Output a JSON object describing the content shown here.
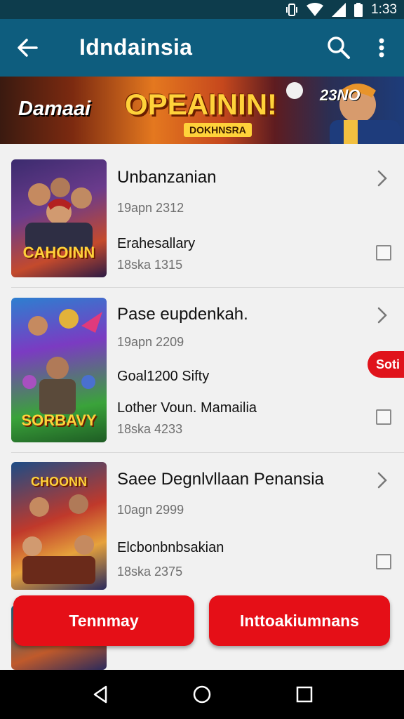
{
  "status_bar": {
    "time": "1:33",
    "icons": [
      "vibrate-icon",
      "wifi-icon",
      "signal-icon",
      "battery-icon"
    ]
  },
  "app_bar": {
    "title": "Idndainsia",
    "icons": [
      "back-arrow-icon",
      "search-icon",
      "more-vert-icon"
    ]
  },
  "banner": {
    "left_text": "Damaai",
    "logo_text": "OPEAININ!",
    "logo_sub": "DOKHNSRA",
    "right_text": "23NO"
  },
  "items": [
    {
      "title": "Unbanzanian",
      "date": "19apn 2312",
      "sub1": "Erahesallary",
      "sub2": "",
      "number": "18ska 1315",
      "thumb_text": "CAHOINN",
      "checked": false
    },
    {
      "title": "Pase eupdenkah.",
      "date": "19apn 2209",
      "sub1": "Goal1200 Sifty",
      "sub2": "Lother Voun. Mamailia",
      "number": "18ska 4233",
      "thumb_text": "SORBAVY",
      "checked": false
    },
    {
      "title": "Saee Degnlvllaan Penansia",
      "date": "10agn 2999",
      "sub1": "Elcbonbnbsakian",
      "sub2": "",
      "number": "18ska 2375",
      "thumb_text": "CHOONN",
      "checked": false
    }
  ],
  "side_pill": {
    "label": "Soti"
  },
  "buttons": {
    "left": "Tennmay",
    "right": "Inttoakiumnans"
  },
  "colors": {
    "app_bar": "#0e5d7e",
    "status_bar": "#0d3c4c",
    "accent": "#e50f17"
  },
  "nav_icons": [
    "back-triangle-icon",
    "home-circle-icon",
    "recents-square-icon"
  ]
}
